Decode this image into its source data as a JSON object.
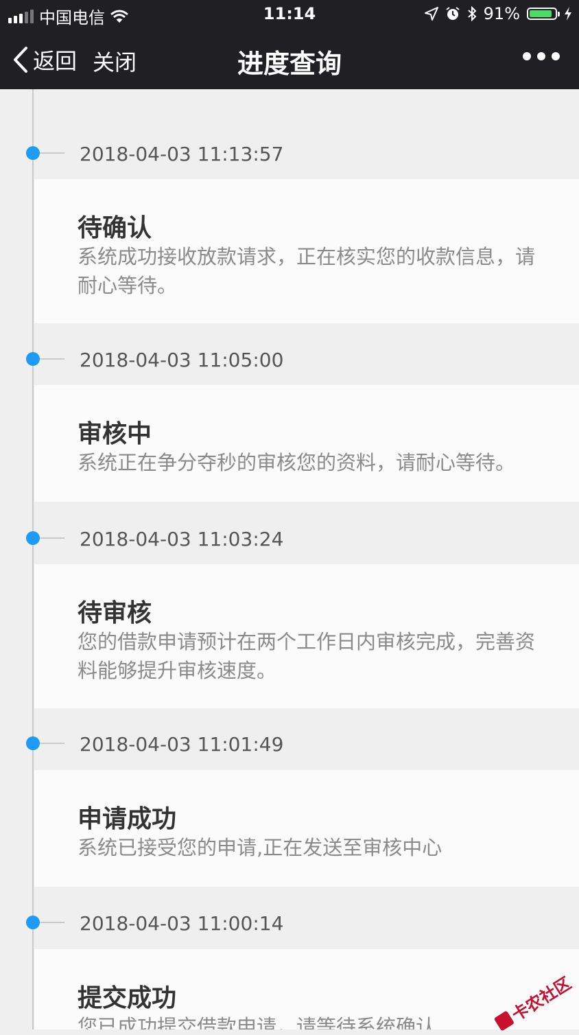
{
  "status_bar": {
    "carrier": "中国电信",
    "time": "11:14",
    "battery_text": "91%",
    "battery_level": 0.91,
    "icons": [
      "signal-icon",
      "wifi-icon",
      "location-icon",
      "alarm-icon",
      "bluetooth-icon",
      "battery-icon",
      "charging-icon"
    ]
  },
  "nav": {
    "back_label": "返回",
    "close_label": "关闭",
    "title": "进度查询",
    "icons": [
      "chevron-left-icon",
      "more-icon"
    ]
  },
  "colors": {
    "bar_bg": "#1f1f24",
    "dot": "#1e9bf5",
    "line": "#c9c9c9",
    "page_bg": "#efefef",
    "card_bg": "#fbfbfb"
  },
  "entries": [
    {
      "timestamp": "2018-04-03 11:13:57",
      "title": "待确认",
      "desc": "系统成功接收放款请求，正在核实您的收款信息，请耐心等待。"
    },
    {
      "timestamp": "2018-04-03 11:05:00",
      "title": "审核中",
      "desc": "系统正在争分夺秒的审核您的资料，请耐心等待。"
    },
    {
      "timestamp": "2018-04-03 11:03:24",
      "title": "待审核",
      "desc": "您的借款申请预计在两个工作日内审核完成，完善资料能够提升审核速度。"
    },
    {
      "timestamp": "2018-04-03 11:01:49",
      "title": "申请成功",
      "desc": "系统已接受您的申请,正在发送至审核中心"
    },
    {
      "timestamp": "2018-04-03 11:00:14",
      "title": "提交成功",
      "desc": "您已成功提交借款申请，请等待系统确认"
    }
  ],
  "watermark": "卡农社区"
}
